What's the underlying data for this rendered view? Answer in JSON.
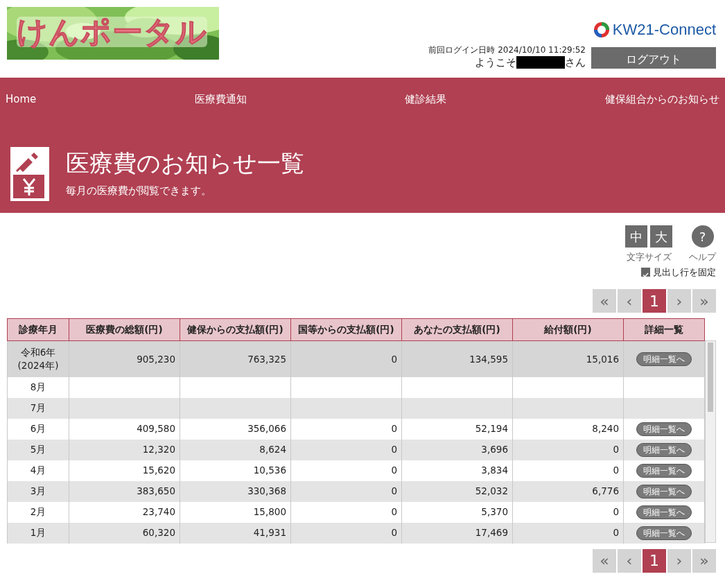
{
  "header": {
    "logo_text": "けんポータル",
    "brand": "KW21-Connect",
    "last_login_label": "前回ログイン日時",
    "last_login": "2024/10/10 11:29:52",
    "welcome_prefix": "ようこそ",
    "welcome_suffix": "さん",
    "logout": "ログアウト"
  },
  "nav": [
    {
      "label": "Home"
    },
    {
      "label": "医療費通知"
    },
    {
      "label": "健診結果"
    },
    {
      "label": "健保組合からのお知らせ"
    }
  ],
  "page": {
    "title": "医療費のお知らせ一覧",
    "subtitle": "毎月の医療費が閲覧できます。"
  },
  "tools": {
    "size_buttons": [
      "中",
      "大"
    ],
    "size_label": "文字サイズ",
    "help_symbol": "?",
    "help_label": "ヘルプ",
    "fix_header": {
      "label": "見出し行を固定",
      "checked": true
    }
  },
  "pagination_top": [
    {
      "label": "«",
      "selected": false
    },
    {
      "label": "‹",
      "selected": false
    },
    {
      "label": "1",
      "selected": true
    },
    {
      "label": "›",
      "selected": false
    },
    {
      "label": "»",
      "selected": false
    }
  ],
  "table": {
    "columns": [
      "診療年月",
      "医療費の総額(円)",
      "健保からの支払額(円)",
      "国等からの支払額(円)",
      "あなたの支払額(円)",
      "給付額(円)",
      "詳細一覧"
    ],
    "rows": [
      {
        "kind": "total",
        "month": "令和6年\n(2024年)",
        "values": [
          "905,230",
          "763,325",
          "0",
          "134,595",
          "15,016"
        ],
        "detail": "明細一覧へ"
      },
      {
        "kind": "month",
        "month": "8月",
        "values": [],
        "detail": ""
      },
      {
        "kind": "month",
        "month": "7月",
        "values": [],
        "detail": ""
      },
      {
        "kind": "month",
        "month": "6月",
        "values": [
          "409,580",
          "356,066",
          "0",
          "52,194",
          "8,240"
        ],
        "detail": "明細一覧へ"
      },
      {
        "kind": "month",
        "month": "5月",
        "values": [
          "12,320",
          "8,624",
          "0",
          "3,696",
          "0"
        ],
        "detail": "明細一覧へ"
      },
      {
        "kind": "month",
        "month": "4月",
        "values": [
          "15,620",
          "10,536",
          "0",
          "3,834",
          "0"
        ],
        "detail": "明細一覧へ"
      },
      {
        "kind": "month",
        "month": "3月",
        "values": [
          "383,650",
          "330,368",
          "0",
          "52,032",
          "6,776"
        ],
        "detail": "明細一覧へ"
      },
      {
        "kind": "month",
        "month": "2月",
        "values": [
          "23,740",
          "15,800",
          "0",
          "5,370",
          "0"
        ],
        "detail": "明細一覧へ"
      },
      {
        "kind": "month",
        "month": "1月",
        "values": [
          "60,320",
          "41,931",
          "0",
          "17,469",
          "0"
        ],
        "detail": "明細一覧へ"
      }
    ]
  },
  "pagination_bottom": [
    {
      "label": "«",
      "selected": false
    },
    {
      "label": "‹",
      "selected": false
    },
    {
      "label": "1",
      "selected": true
    },
    {
      "label": "›",
      "selected": false
    },
    {
      "label": "»",
      "selected": false
    }
  ]
}
